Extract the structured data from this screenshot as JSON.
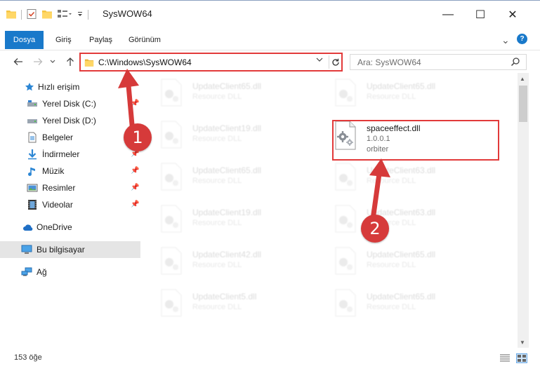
{
  "window": {
    "title": "SysWOW64",
    "minimize": "—",
    "maximize": "☐",
    "close": "✕"
  },
  "ribbon": {
    "tabs": [
      "Dosya",
      "Giriş",
      "Paylaş",
      "Görünüm"
    ],
    "help": "?",
    "expand": "⌄"
  },
  "address": {
    "path": "C:\\Windows\\SysWOW64",
    "search_placeholder": "Ara: SysWOW64"
  },
  "nav": {
    "quick_access": "Hızlı erişim",
    "items": [
      {
        "label": "Yerel Disk (C:)",
        "icon": "drive-icon"
      },
      {
        "label": "Yerel Disk (D:)",
        "icon": "drive-icon"
      },
      {
        "label": "Belgeler",
        "icon": "documents-icon"
      },
      {
        "label": "İndirmeler",
        "icon": "downloads-icon"
      },
      {
        "label": "Müzik",
        "icon": "music-icon"
      },
      {
        "label": "Resimler",
        "icon": "pictures-icon"
      },
      {
        "label": "Videolar",
        "icon": "videos-icon"
      }
    ],
    "onedrive": "OneDrive",
    "this_pc": "Bu bilgisayar",
    "network": "Ağ"
  },
  "files": {
    "left": [
      {
        "name": "UpdateClient65.dll",
        "desc": "Resource DLL"
      },
      {
        "name": "UpdateClient19.dll",
        "desc": "Resource DLL"
      },
      {
        "name": "UpdateClient65.dll",
        "desc": "Resource DLL"
      },
      {
        "name": "UpdateClient19.dll",
        "desc": "Resource DLL"
      },
      {
        "name": "UpdateClient42.dll",
        "desc": "Resource DLL"
      },
      {
        "name": "UpdateClient5.dll",
        "desc": "Resource DLL"
      }
    ],
    "right": [
      {
        "name": "UpdateClient65.dll",
        "desc": "Resource DLL"
      },
      {
        "name": "UpdateClient63.dll",
        "desc": "Resource DLL"
      },
      {
        "name": "UpdateClient63.dll",
        "desc": "Resource DLL"
      },
      {
        "name": "UpdateClient65.dll",
        "desc": "Resource DLL"
      },
      {
        "name": "UpdateClient65.dll",
        "desc": "Resource DLL"
      }
    ],
    "featured": {
      "name": "spaceeffect.dll",
      "version": "1.0.0.1",
      "company": "orbiter"
    }
  },
  "status": {
    "count": "153 öğe"
  },
  "annotations": {
    "step1": "1",
    "step2": "2",
    "color": "#d63a3a"
  }
}
